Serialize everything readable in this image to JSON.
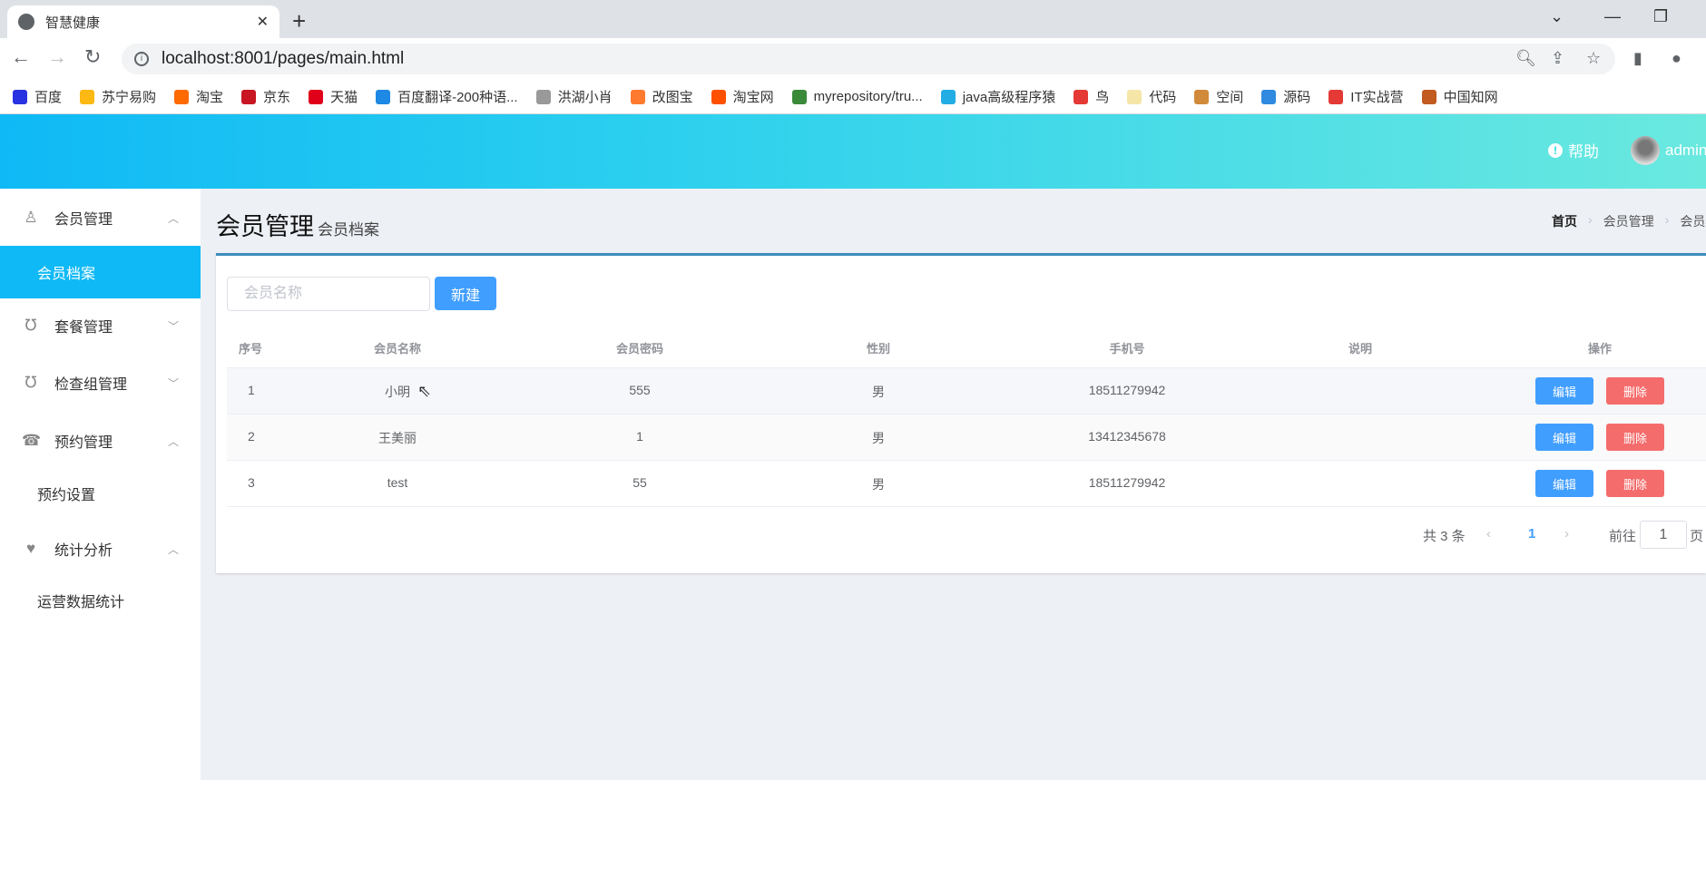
{
  "browser": {
    "tab_title": "智慧健康",
    "url": "localhost:8001/pages/main.html",
    "bookmarks": [
      {
        "label": "百度",
        "color": "#2932e1"
      },
      {
        "label": "苏宁易购",
        "color": "#fcb813"
      },
      {
        "label": "淘宝",
        "color": "#ff6a00"
      },
      {
        "label": "京东",
        "color": "#c91623"
      },
      {
        "label": "天猫",
        "color": "#e1001a"
      },
      {
        "label": "百度翻译-200种语...",
        "color": "#1e88e5"
      },
      {
        "label": "洪湖小肖",
        "color": "#999999"
      },
      {
        "label": "改图宝",
        "color": "#ff7a2e"
      },
      {
        "label": "淘宝网",
        "color": "#ff5000"
      },
      {
        "label": "myrepository/tru...",
        "color": "#3a8a3a"
      },
      {
        "label": "java高级程序猿",
        "color": "#23ade5"
      },
      {
        "label": "鸟",
        "color": "#e53935"
      },
      {
        "label": "代码",
        "color": "#f5e6a8"
      },
      {
        "label": "空间",
        "color": "#d08a3a"
      },
      {
        "label": "源码",
        "color": "#2f8ae0"
      },
      {
        "label": "IT实战营",
        "color": "#e53935"
      },
      {
        "label": "中国知网",
        "color": "#c25b20"
      }
    ]
  },
  "header": {
    "help": "帮助",
    "user": "admin"
  },
  "sidebar": {
    "items": [
      {
        "label": "会员管理",
        "icon": "user-doctor-icon",
        "chevron": "^"
      },
      {
        "label": "会员档案",
        "sub": true,
        "active": true
      },
      {
        "label": "套餐管理",
        "icon": "stethoscope-icon",
        "chevron": "v"
      },
      {
        "label": "检查组管理",
        "icon": "stethoscope-icon",
        "chevron": "v"
      },
      {
        "label": "预约管理",
        "icon": "phone-icon",
        "chevron": "^"
      },
      {
        "label": "预约设置",
        "sub": true
      },
      {
        "label": "统计分析",
        "icon": "heartbeat-icon",
        "chevron": "^"
      },
      {
        "label": "运营数据统计",
        "sub": true
      }
    ]
  },
  "page": {
    "title": "会员管理",
    "subtitle": "会员档案",
    "breadcrumb": [
      "首页",
      "会员管理",
      "会员档案"
    ]
  },
  "toolbar": {
    "search_placeholder": "会员名称",
    "new_label": "新建"
  },
  "table": {
    "headers": [
      "序号",
      "会员名称",
      "会员密码",
      "性别",
      "手机号",
      "说明",
      "操作"
    ],
    "rows": [
      [
        "1",
        "小明",
        "555",
        "男",
        "18511279942",
        ""
      ],
      [
        "2",
        "王美丽",
        "1",
        "男",
        "13412345678",
        ""
      ],
      [
        "3",
        "test",
        "55",
        "男",
        "18511279942",
        ""
      ]
    ],
    "edit_label": "编辑",
    "delete_label": "删除"
  },
  "pagination": {
    "total": "共 3 条",
    "prev": "‹",
    "current": "1",
    "next": "›",
    "goto": "前往",
    "page_value": "1",
    "page_suffix": "页"
  }
}
